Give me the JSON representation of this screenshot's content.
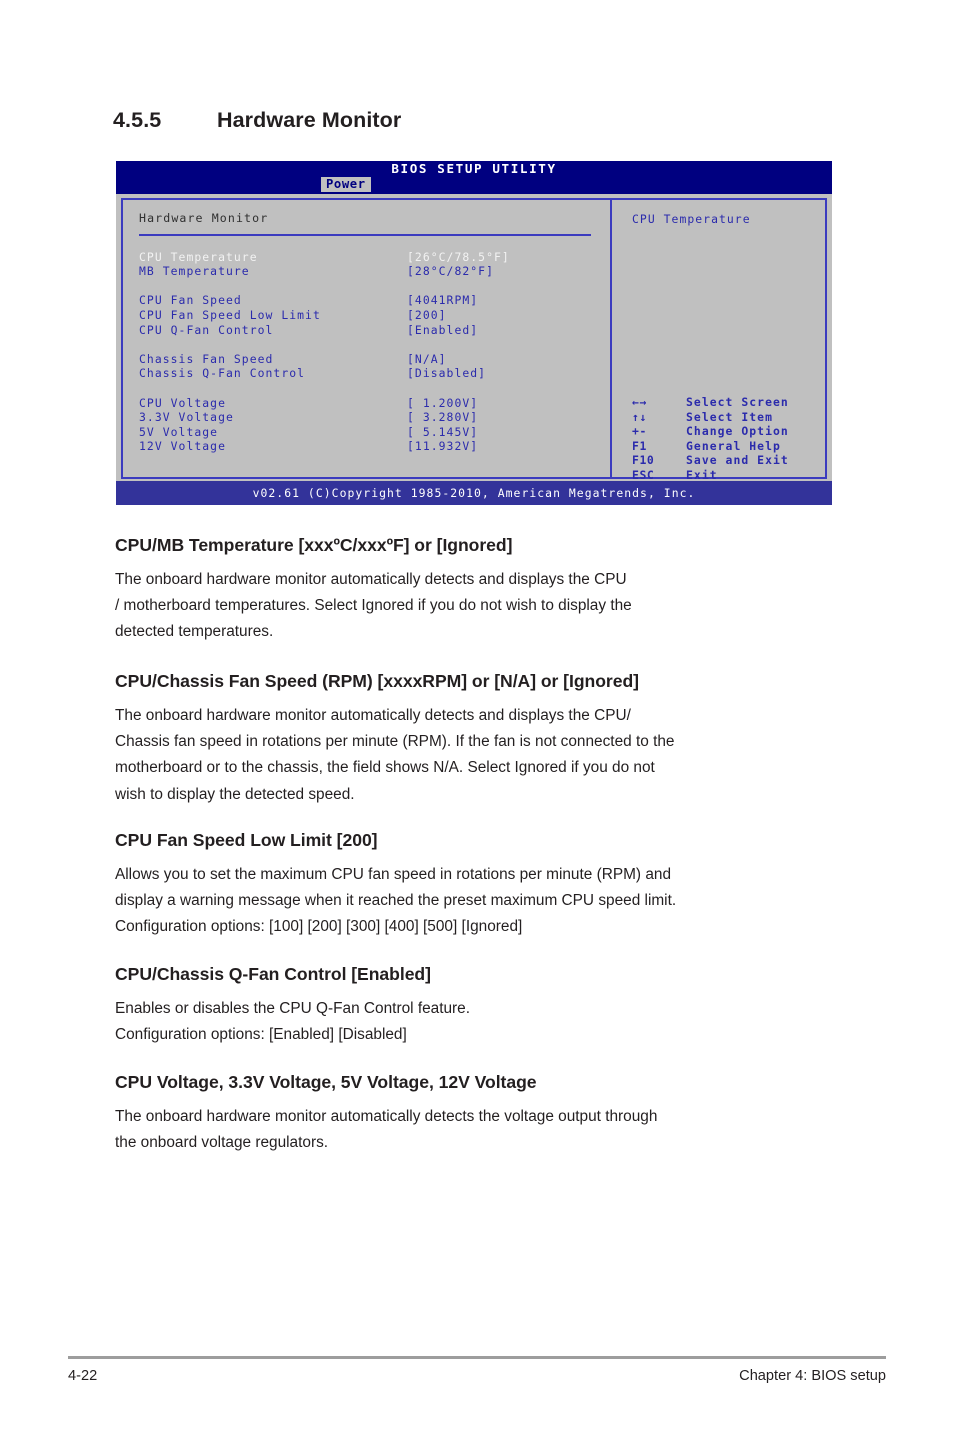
{
  "page": {
    "section_number": "4.5.5",
    "section_title": "Hardware Monitor",
    "footer_page": "4-22",
    "footer_chapter": "Chapter 4: BIOS setup"
  },
  "bios": {
    "title": "BIOS SETUP UTILITY",
    "active_tab": "Power",
    "panel_heading": "Hardware Monitor",
    "items": [
      {
        "label": "CPU Temperature",
        "value": "[26°C/78.5°F]",
        "selected": true
      },
      {
        "label": "MB Temperature",
        "value": "[28°C/82°F]",
        "selected": false
      },
      {
        "label": "",
        "value": "",
        "spacer": true
      },
      {
        "label": "CPU Fan Speed",
        "value": "[4041RPM]",
        "selected": false
      },
      {
        "label": "CPU Fan Speed Low Limit",
        "value": "[200]",
        "selected": false
      },
      {
        "label": "CPU Q-Fan Control",
        "value": "[Enabled]",
        "selected": false
      },
      {
        "label": "",
        "value": "",
        "spacer": true
      },
      {
        "label": "Chassis Fan Speed",
        "value": "[N/A]",
        "selected": false
      },
      {
        "label": "Chassis Q-Fan Control",
        "value": "[Disabled]",
        "selected": false
      },
      {
        "label": "",
        "value": "",
        "spacer": true
      },
      {
        "label": "CPU Voltage",
        "value": "[ 1.200V]",
        "selected": false
      },
      {
        "label": "3.3V Voltage",
        "value": "[ 3.280V]",
        "selected": false
      },
      {
        "label": "5V Voltage",
        "value": "[ 5.145V]",
        "selected": false
      },
      {
        "label": "12V Voltage",
        "value": "[11.932V]",
        "selected": false
      }
    ],
    "help_title": "CPU Temperature",
    "legend": [
      {
        "key": "←→",
        "desc": "Select Screen",
        "icon": "left-right-arrow-icon"
      },
      {
        "key": "↑↓",
        "desc": "Select Item",
        "icon": "up-down-arrow-icon"
      },
      {
        "key": "+-",
        "desc": "Change Option",
        "icon": "plus-minus-icon"
      },
      {
        "key": "F1",
        "desc": "General Help",
        "icon": "f1-key-icon"
      },
      {
        "key": "F10",
        "desc": "Save and Exit",
        "icon": "f10-key-icon"
      },
      {
        "key": "ESC",
        "desc": "Exit",
        "icon": "esc-key-icon"
      }
    ],
    "footer": "v02.61 (C)Copyright 1985-2010, American Megatrends, Inc.",
    "colors": {
      "titlebar": "#000080",
      "footer_bar": "#33339a",
      "panel_bg": "#c0c0c0",
      "border": "#3b3bbf",
      "text_blue": "#2b2bac",
      "text_selected": "#f2f2f2"
    }
  },
  "sections": [
    {
      "heading": "CPU/MB Temperature [xxxºC/xxxºF] or [Ignored]",
      "lines": [
        "The onboard hardware monitor automatically detects and displays the CPU",
        "/ motherboard temperatures. Select Ignored if you do not wish to display the",
        "detected temperatures."
      ]
    },
    {
      "heading": "CPU/Chassis Fan Speed (RPM) [xxxxRPM] or [N/A] or [Ignored]",
      "lines": [
        "The onboard hardware monitor automatically detects and displays the CPU/",
        "Chassis fan speed in rotations per minute (RPM). If the fan is not connected to the",
        "motherboard or to the chassis, the field shows N/A. Select Ignored if you do not",
        "wish to display the detected speed."
      ]
    },
    {
      "heading": "CPU Fan Speed Low Limit [200]",
      "lines": [
        "Allows you to set the maximum CPU fan speed in rotations per minute (RPM) and",
        "display a warning message when it reached the preset maximum CPU speed limit.",
        "Configuration options: [100] [200] [300] [400] [500] [Ignored]"
      ]
    },
    {
      "heading": "CPU/Chassis Q-Fan Control  [Enabled]",
      "lines": [
        "Enables or disables the CPU Q-Fan Control feature.",
        "Configuration options: [Enabled] [Disabled]"
      ]
    },
    {
      "heading": "CPU Voltage, 3.3V Voltage, 5V Voltage, 12V Voltage",
      "lines": [
        "The onboard hardware monitor automatically detects the voltage output through",
        "the onboard voltage regulators."
      ]
    }
  ]
}
